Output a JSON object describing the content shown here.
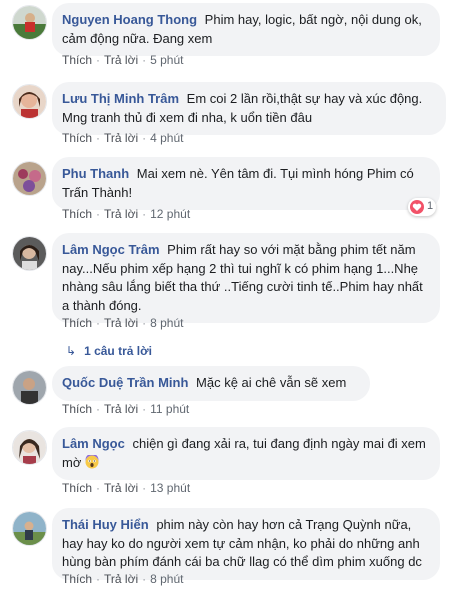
{
  "comments": [
    {
      "author": "Nguyen Hoang Thong",
      "text": "Phim hay, logic, bất ngờ, nội dung ok, cảm động nữa. Đang xem",
      "like": "Thích",
      "reply": "Trả lời",
      "time": "5 phút"
    },
    {
      "author": "Lưu Thị Minh Trâm",
      "text": "Em coi 2 lần rồi,thật sự hay và xúc động. Mng tranh thủ đi xem đi nha, k uổn tiền đâu",
      "like": "Thích",
      "reply": "Trả lời",
      "time": "4 phút"
    },
    {
      "author": "Phu Thanh",
      "text": "Mai xem nè. Yên tâm đi. Tụi mình hóng Phim có Trấn Thành!",
      "like": "Thích",
      "reply": "Trả lời",
      "time": "12 phút",
      "reaction_count": "1"
    },
    {
      "author": "Lâm Ngọc Trâm",
      "text": "Phim rất hay so với mặt bằng phim tết năm nay...Nếu phim xếp hạng 2 thì tui nghĩ k có phim hạng 1...Nhẹ nhàng sâu lắng biết tha thứ ..Tiếng cười tinh tế..Phim hay nhất a thành đóng.",
      "like": "Thích",
      "reply": "Trả lời",
      "time": "8 phút",
      "replies_label": "1 câu trả lời"
    },
    {
      "author": "Quốc Duệ Trần Minh",
      "text": "Mặc kệ ai chê vẫn sẽ xem",
      "like": "Thích",
      "reply": "Trả lời",
      "time": "11 phút"
    },
    {
      "author": "Lâm Ngọc",
      "text": "chiện gì đang xải ra, tui đang định ngày mai đi xem mờ",
      "like": "Thích",
      "reply": "Trả lời",
      "time": "13 phút",
      "emoji": "shocked-face"
    },
    {
      "author": "Thái Huy Hiển",
      "text": "phim này còn hay hơn cả Trạng Quỳnh nữa, hay hay ko do người xem tự cảm nhận, ko phải do những anh hùng bàn phím đánh cái ba chữ llag có thể dìm phim xuống dc",
      "like": "Thích",
      "reply": "Trả lời",
      "time": "8 phút"
    }
  ],
  "colors": {
    "author": "#385898",
    "bubble": "#f2f3f5",
    "meta": "#606770",
    "reaction_heart": "#f25268"
  }
}
